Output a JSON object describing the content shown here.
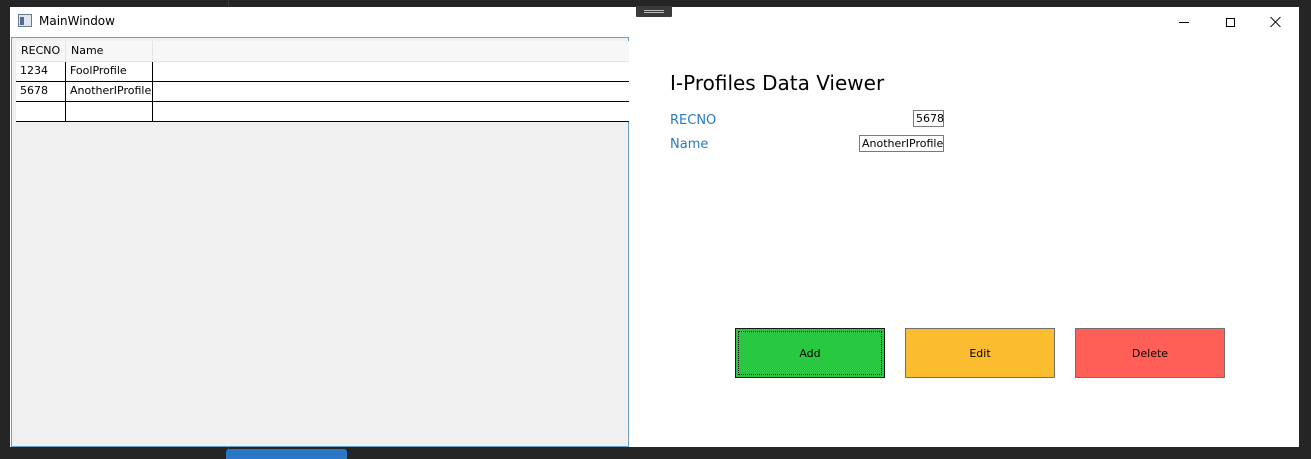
{
  "window": {
    "title": "MainWindow"
  },
  "grid": {
    "columns": [
      "RECNO",
      "Name",
      ""
    ],
    "rows": [
      [
        "1234",
        "FoolProfile",
        ""
      ],
      [
        "5678",
        "AnotherIProfile",
        ""
      ],
      [
        "",
        "",
        ""
      ]
    ]
  },
  "detail": {
    "title": "I-Profiles Data Viewer",
    "recno_label": "RECNO",
    "recno_value": "5678",
    "name_label": "Name",
    "name_value": "AnotherIProfile"
  },
  "actions": {
    "add_label": "Add",
    "edit_label": "Edit",
    "delete_label": "Delete"
  },
  "colors": {
    "add": "#28c840",
    "edit": "#fbbc2f",
    "delete": "#ff5f57",
    "label_blue": "#2b78c5"
  },
  "icons": {
    "app": "app-window-icon",
    "minimize": "minimize-icon",
    "maximize": "maximize-icon",
    "close": "close-icon"
  }
}
